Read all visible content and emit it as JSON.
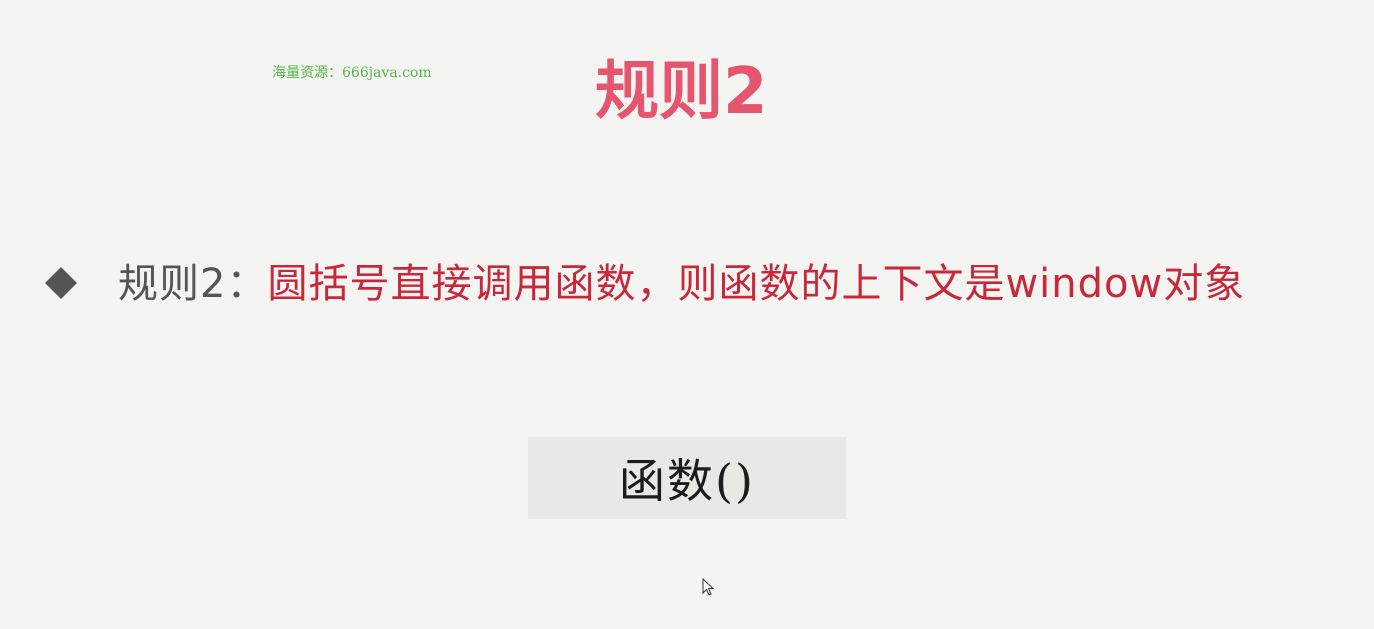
{
  "watermark": "海量资源：666java.com",
  "title": "规则2",
  "rule": {
    "label": "规则2：",
    "text": "圆括号直接调用函数，则函数的上下文是window对象"
  },
  "code_example": "函数()",
  "colors": {
    "title": "#e5556e",
    "rule_text": "#c8283a",
    "label": "#555555",
    "watermark": "#55b84a",
    "code_box_bg": "#e8e8e4"
  },
  "icons": {
    "bullet": "diamond-bullet-icon",
    "cursor": "mouse-pointer-icon"
  }
}
